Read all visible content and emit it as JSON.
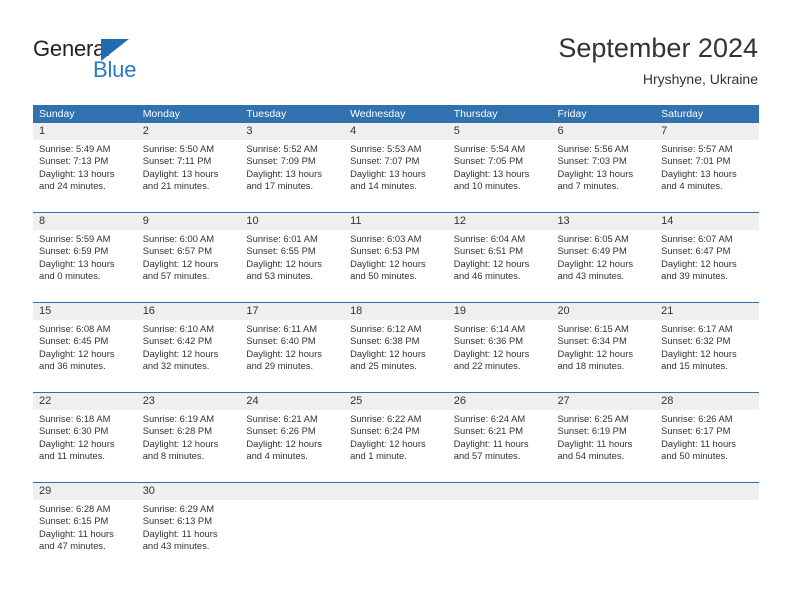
{
  "logo": {
    "word_top": "General",
    "word_bottom": "Blue",
    "triangle_color": "#1f6cb0",
    "top_color": "#231f20",
    "bottom_color": "#2a7ac0"
  },
  "header": {
    "title": "September 2024",
    "subtitle": "Hryshyne, Ukraine"
  },
  "theme": {
    "header_blue": "#3071b0",
    "daynum_band": "#efefef",
    "text": "#333333"
  },
  "weekday_headers": [
    "Sunday",
    "Monday",
    "Tuesday",
    "Wednesday",
    "Thursday",
    "Friday",
    "Saturday"
  ],
  "weeks": [
    [
      {
        "day": "1",
        "sunrise": "Sunrise: 5:49 AM",
        "sunset": "Sunset: 7:13 PM",
        "daylight1": "Daylight: 13 hours",
        "daylight2": "and 24 minutes."
      },
      {
        "day": "2",
        "sunrise": "Sunrise: 5:50 AM",
        "sunset": "Sunset: 7:11 PM",
        "daylight1": "Daylight: 13 hours",
        "daylight2": "and 21 minutes."
      },
      {
        "day": "3",
        "sunrise": "Sunrise: 5:52 AM",
        "sunset": "Sunset: 7:09 PM",
        "daylight1": "Daylight: 13 hours",
        "daylight2": "and 17 minutes."
      },
      {
        "day": "4",
        "sunrise": "Sunrise: 5:53 AM",
        "sunset": "Sunset: 7:07 PM",
        "daylight1": "Daylight: 13 hours",
        "daylight2": "and 14 minutes."
      },
      {
        "day": "5",
        "sunrise": "Sunrise: 5:54 AM",
        "sunset": "Sunset: 7:05 PM",
        "daylight1": "Daylight: 13 hours",
        "daylight2": "and 10 minutes."
      },
      {
        "day": "6",
        "sunrise": "Sunrise: 5:56 AM",
        "sunset": "Sunset: 7:03 PM",
        "daylight1": "Daylight: 13 hours",
        "daylight2": "and 7 minutes."
      },
      {
        "day": "7",
        "sunrise": "Sunrise: 5:57 AM",
        "sunset": "Sunset: 7:01 PM",
        "daylight1": "Daylight: 13 hours",
        "daylight2": "and 4 minutes."
      }
    ],
    [
      {
        "day": "8",
        "sunrise": "Sunrise: 5:59 AM",
        "sunset": "Sunset: 6:59 PM",
        "daylight1": "Daylight: 13 hours",
        "daylight2": "and 0 minutes."
      },
      {
        "day": "9",
        "sunrise": "Sunrise: 6:00 AM",
        "sunset": "Sunset: 6:57 PM",
        "daylight1": "Daylight: 12 hours",
        "daylight2": "and 57 minutes."
      },
      {
        "day": "10",
        "sunrise": "Sunrise: 6:01 AM",
        "sunset": "Sunset: 6:55 PM",
        "daylight1": "Daylight: 12 hours",
        "daylight2": "and 53 minutes."
      },
      {
        "day": "11",
        "sunrise": "Sunrise: 6:03 AM",
        "sunset": "Sunset: 6:53 PM",
        "daylight1": "Daylight: 12 hours",
        "daylight2": "and 50 minutes."
      },
      {
        "day": "12",
        "sunrise": "Sunrise: 6:04 AM",
        "sunset": "Sunset: 6:51 PM",
        "daylight1": "Daylight: 12 hours",
        "daylight2": "and 46 minutes."
      },
      {
        "day": "13",
        "sunrise": "Sunrise: 6:05 AM",
        "sunset": "Sunset: 6:49 PM",
        "daylight1": "Daylight: 12 hours",
        "daylight2": "and 43 minutes."
      },
      {
        "day": "14",
        "sunrise": "Sunrise: 6:07 AM",
        "sunset": "Sunset: 6:47 PM",
        "daylight1": "Daylight: 12 hours",
        "daylight2": "and 39 minutes."
      }
    ],
    [
      {
        "day": "15",
        "sunrise": "Sunrise: 6:08 AM",
        "sunset": "Sunset: 6:45 PM",
        "daylight1": "Daylight: 12 hours",
        "daylight2": "and 36 minutes."
      },
      {
        "day": "16",
        "sunrise": "Sunrise: 6:10 AM",
        "sunset": "Sunset: 6:42 PM",
        "daylight1": "Daylight: 12 hours",
        "daylight2": "and 32 minutes."
      },
      {
        "day": "17",
        "sunrise": "Sunrise: 6:11 AM",
        "sunset": "Sunset: 6:40 PM",
        "daylight1": "Daylight: 12 hours",
        "daylight2": "and 29 minutes."
      },
      {
        "day": "18",
        "sunrise": "Sunrise: 6:12 AM",
        "sunset": "Sunset: 6:38 PM",
        "daylight1": "Daylight: 12 hours",
        "daylight2": "and 25 minutes."
      },
      {
        "day": "19",
        "sunrise": "Sunrise: 6:14 AM",
        "sunset": "Sunset: 6:36 PM",
        "daylight1": "Daylight: 12 hours",
        "daylight2": "and 22 minutes."
      },
      {
        "day": "20",
        "sunrise": "Sunrise: 6:15 AM",
        "sunset": "Sunset: 6:34 PM",
        "daylight1": "Daylight: 12 hours",
        "daylight2": "and 18 minutes."
      },
      {
        "day": "21",
        "sunrise": "Sunrise: 6:17 AM",
        "sunset": "Sunset: 6:32 PM",
        "daylight1": "Daylight: 12 hours",
        "daylight2": "and 15 minutes."
      }
    ],
    [
      {
        "day": "22",
        "sunrise": "Sunrise: 6:18 AM",
        "sunset": "Sunset: 6:30 PM",
        "daylight1": "Daylight: 12 hours",
        "daylight2": "and 11 minutes."
      },
      {
        "day": "23",
        "sunrise": "Sunrise: 6:19 AM",
        "sunset": "Sunset: 6:28 PM",
        "daylight1": "Daylight: 12 hours",
        "daylight2": "and 8 minutes."
      },
      {
        "day": "24",
        "sunrise": "Sunrise: 6:21 AM",
        "sunset": "Sunset: 6:26 PM",
        "daylight1": "Daylight: 12 hours",
        "daylight2": "and 4 minutes."
      },
      {
        "day": "25",
        "sunrise": "Sunrise: 6:22 AM",
        "sunset": "Sunset: 6:24 PM",
        "daylight1": "Daylight: 12 hours",
        "daylight2": "and 1 minute."
      },
      {
        "day": "26",
        "sunrise": "Sunrise: 6:24 AM",
        "sunset": "Sunset: 6:21 PM",
        "daylight1": "Daylight: 11 hours",
        "daylight2": "and 57 minutes."
      },
      {
        "day": "27",
        "sunrise": "Sunrise: 6:25 AM",
        "sunset": "Sunset: 6:19 PM",
        "daylight1": "Daylight: 11 hours",
        "daylight2": "and 54 minutes."
      },
      {
        "day": "28",
        "sunrise": "Sunrise: 6:26 AM",
        "sunset": "Sunset: 6:17 PM",
        "daylight1": "Daylight: 11 hours",
        "daylight2": "and 50 minutes."
      }
    ],
    [
      {
        "day": "29",
        "sunrise": "Sunrise: 6:28 AM",
        "sunset": "Sunset: 6:15 PM",
        "daylight1": "Daylight: 11 hours",
        "daylight2": "and 47 minutes."
      },
      {
        "day": "30",
        "sunrise": "Sunrise: 6:29 AM",
        "sunset": "Sunset: 6:13 PM",
        "daylight1": "Daylight: 11 hours",
        "daylight2": "and 43 minutes."
      },
      {
        "day": "",
        "sunrise": "",
        "sunset": "",
        "daylight1": "",
        "daylight2": ""
      },
      {
        "day": "",
        "sunrise": "",
        "sunset": "",
        "daylight1": "",
        "daylight2": ""
      },
      {
        "day": "",
        "sunrise": "",
        "sunset": "",
        "daylight1": "",
        "daylight2": ""
      },
      {
        "day": "",
        "sunrise": "",
        "sunset": "",
        "daylight1": "",
        "daylight2": ""
      },
      {
        "day": "",
        "sunrise": "",
        "sunset": "",
        "daylight1": "",
        "daylight2": ""
      }
    ]
  ]
}
